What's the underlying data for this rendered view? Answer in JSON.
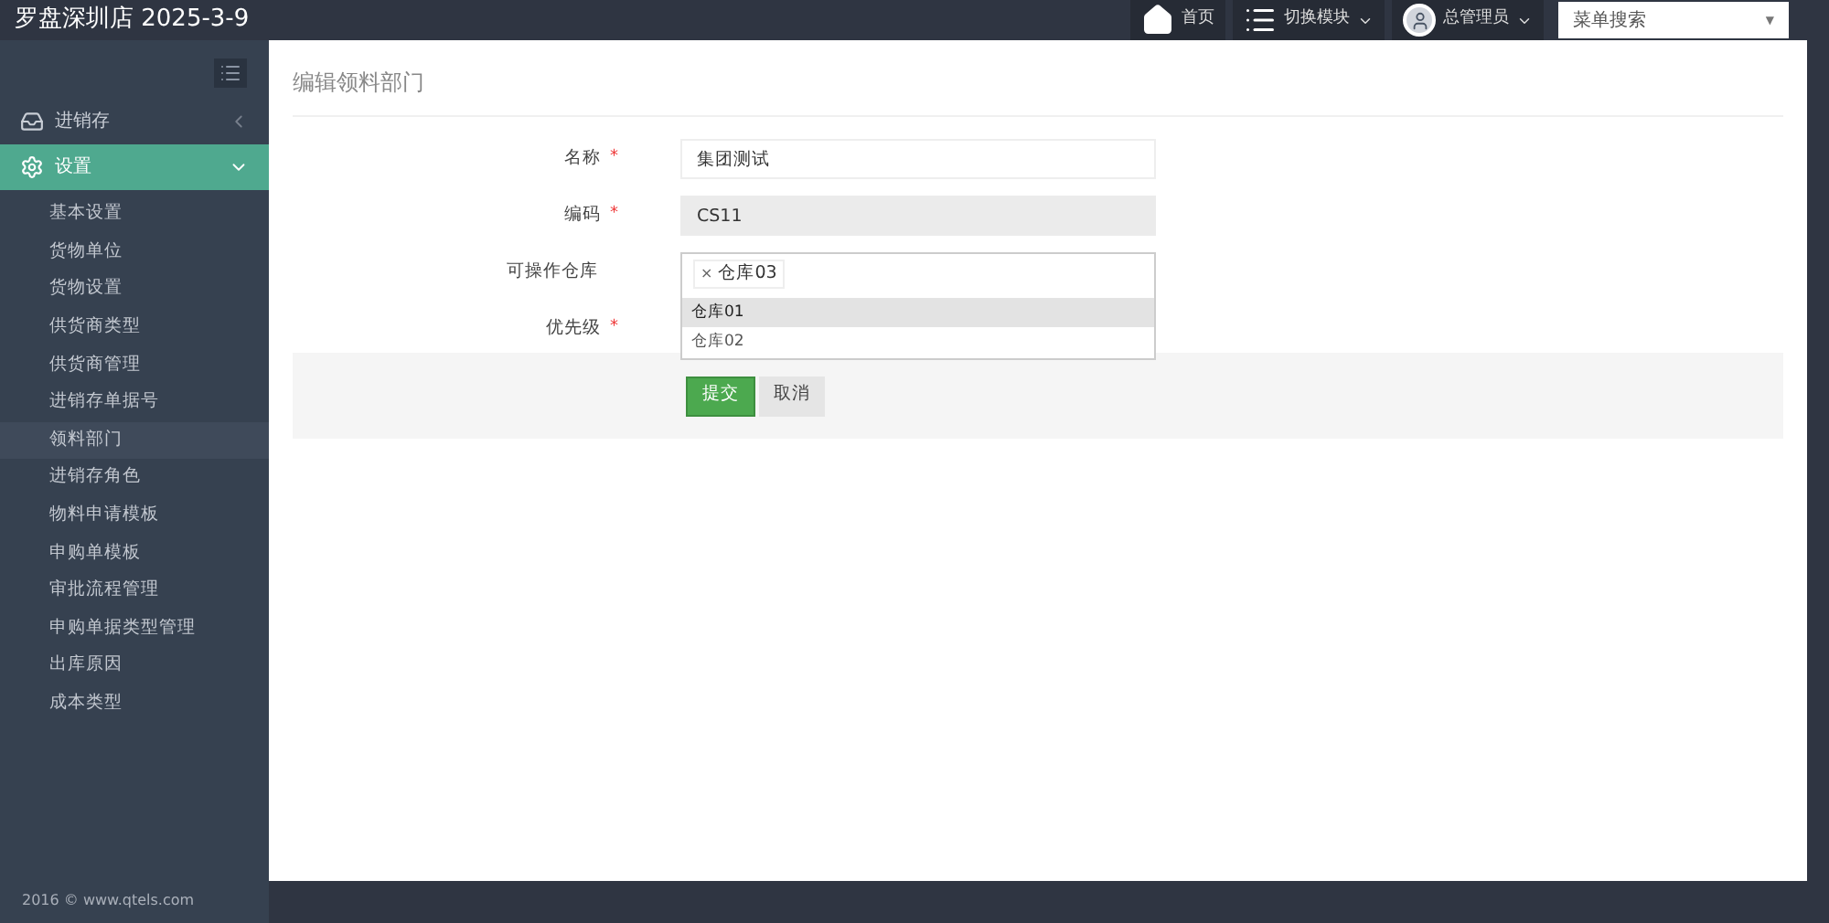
{
  "header": {
    "brand": "罗盘深圳店 2025-3-9",
    "nav": [
      {
        "kind": "home",
        "label": "首页",
        "caret": false
      },
      {
        "kind": "modules",
        "label": "切换模块",
        "caret": true
      },
      {
        "kind": "user",
        "label": "总管理员",
        "caret": true
      }
    ],
    "search": {
      "placeholder": "菜单搜索",
      "arrow": "▼"
    }
  },
  "sidebar": {
    "groups": [
      {
        "kind": "inbox",
        "label": "进销存",
        "expanded": false
      },
      {
        "kind": "gear",
        "label": "设置",
        "expanded": true,
        "children": [
          {
            "label": "基本设置",
            "selected": false
          },
          {
            "label": "货物单位",
            "selected": false
          },
          {
            "label": "货物设置",
            "selected": false
          },
          {
            "label": "供货商类型",
            "selected": false
          },
          {
            "label": "供货商管理",
            "selected": false
          },
          {
            "label": "进销存单据号",
            "selected": false
          },
          {
            "label": "领料部门",
            "selected": true
          },
          {
            "label": "进销存角色",
            "selected": false
          },
          {
            "label": "物料申请模板",
            "selected": false
          },
          {
            "label": "申购单模板",
            "selected": false
          },
          {
            "label": "审批流程管理",
            "selected": false
          },
          {
            "label": "申购单据类型管理",
            "selected": false
          },
          {
            "label": "出库原因",
            "selected": false
          },
          {
            "label": "成本类型",
            "selected": false
          }
        ]
      }
    ]
  },
  "page": {
    "title": "编辑领料部门",
    "fields": [
      {
        "kind": "text",
        "label": "名称",
        "required_mark": "*",
        "value": "集团测试",
        "disabled": false
      },
      {
        "kind": "text",
        "label": "编码",
        "required_mark": "*",
        "value": "CS11",
        "disabled": true
      },
      {
        "kind": "multiselect",
        "label": "可操作仓库",
        "tags": [
          {
            "remove": "×",
            "label": "仓库03"
          }
        ],
        "options": [
          {
            "label": "仓库01",
            "selected": true
          },
          {
            "label": "仓库02",
            "selected": false
          }
        ]
      },
      {
        "kind": "hidden",
        "label": "优先级",
        "required_mark": "*"
      }
    ],
    "buttons": [
      {
        "kind": "primary",
        "label": "提交"
      },
      {
        "kind": "default",
        "label": "取消"
      }
    ]
  },
  "footer": "2016 © www.qtels.com"
}
